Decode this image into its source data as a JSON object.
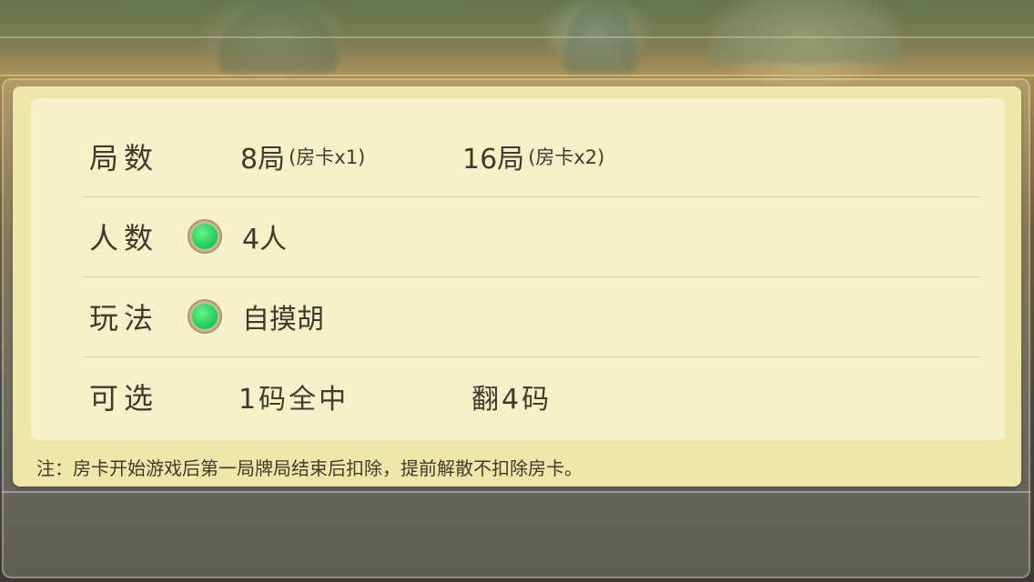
{
  "rounds": {
    "label": "局数",
    "options": [
      {
        "text": "8局",
        "note": "(房卡x1)"
      },
      {
        "text": "16局",
        "note": "(房卡x2)"
      }
    ]
  },
  "players": {
    "label": "人数",
    "option": {
      "text": "4人",
      "selected": true
    }
  },
  "rules": {
    "label": "玩法",
    "option": {
      "text": "自摸胡",
      "selected": true
    }
  },
  "optional": {
    "label": "可选",
    "options": [
      {
        "text": "1码全中"
      },
      {
        "text": "翻4码"
      }
    ]
  },
  "footer_note": "注：房卡开始游戏后第一局牌局结束后扣除，提前解散不扣除房卡。",
  "colors": {
    "dialog_bg": "#efe7a9",
    "inner_bg": "#f6f1c8",
    "text": "#403a2c",
    "radio_selected": "#26d45d"
  }
}
